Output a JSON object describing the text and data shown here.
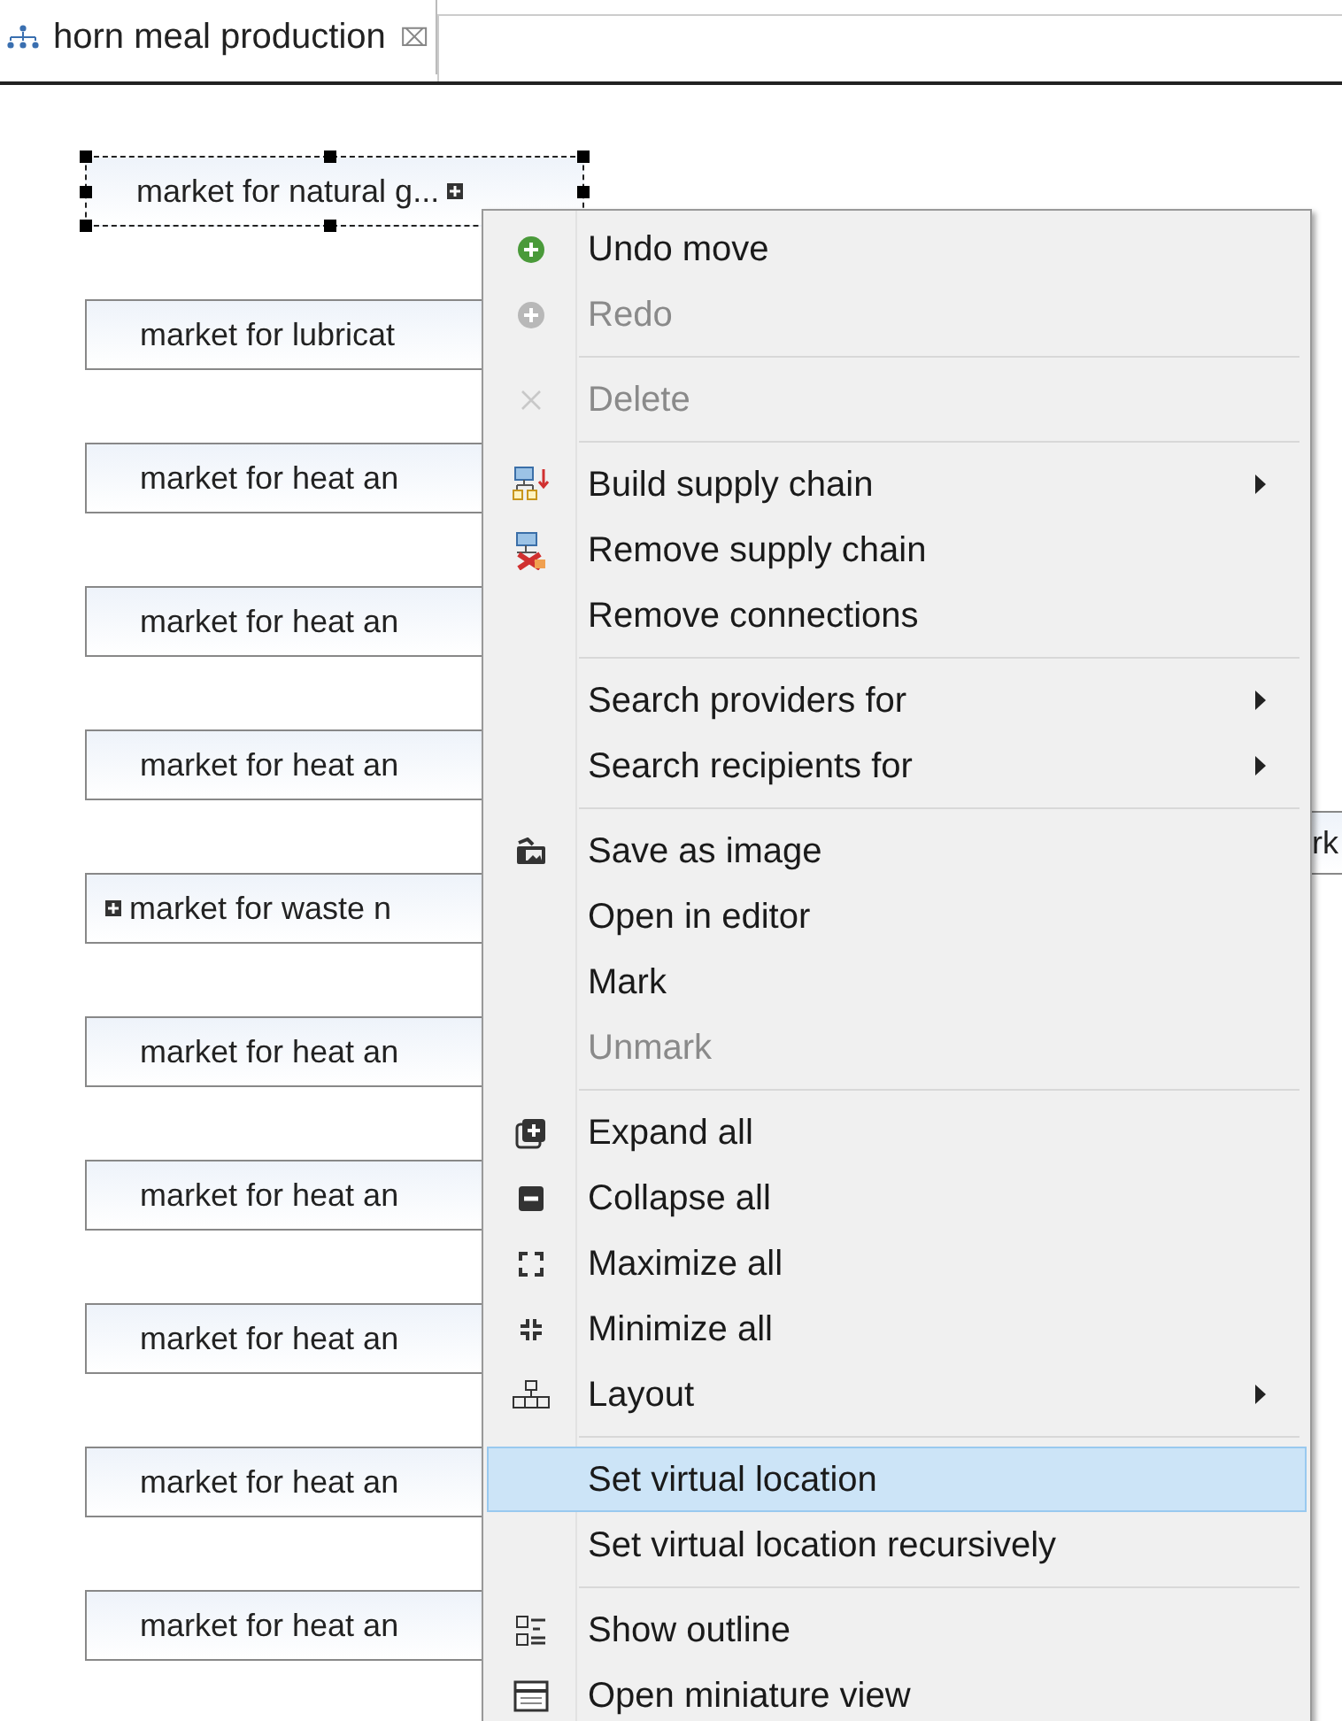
{
  "tab": {
    "title": "horn meal production",
    "close": "⌧"
  },
  "nodes": [
    {
      "label": "market for natural g...",
      "selected": true,
      "expander_left": false,
      "expander_right": true
    },
    {
      "label": "market for lubricat",
      "selected": false,
      "expander_left": false,
      "expander_right": false
    },
    {
      "label": "market for heat an",
      "selected": false,
      "expander_left": false,
      "expander_right": false
    },
    {
      "label": "market for heat an",
      "selected": false,
      "expander_left": false,
      "expander_right": false
    },
    {
      "label": "market for heat an",
      "selected": false,
      "expander_left": false,
      "expander_right": false
    },
    {
      "label": "market for waste n",
      "selected": false,
      "expander_left": true,
      "expander_right": false
    },
    {
      "label": "market for heat an",
      "selected": false,
      "expander_left": false,
      "expander_right": false
    },
    {
      "label": "market for heat an",
      "selected": false,
      "expander_left": false,
      "expander_right": false
    },
    {
      "label": "market for heat an",
      "selected": false,
      "expander_left": false,
      "expander_right": false
    },
    {
      "label": "market for heat an",
      "selected": false,
      "expander_left": false,
      "expander_right": false
    },
    {
      "label": "market for heat an",
      "selected": false,
      "expander_left": false,
      "expander_right": false
    }
  ],
  "side_node": {
    "label": "rk"
  },
  "context_menu": [
    {
      "kind": "item",
      "label": "Undo move",
      "disabled": false,
      "submenu": false,
      "selected": false
    },
    {
      "kind": "item",
      "label": "Redo",
      "disabled": true,
      "submenu": false,
      "selected": false
    },
    {
      "kind": "separator"
    },
    {
      "kind": "item",
      "label": "Delete",
      "disabled": true,
      "submenu": false,
      "selected": false
    },
    {
      "kind": "separator"
    },
    {
      "kind": "item",
      "label": "Build supply chain",
      "disabled": false,
      "submenu": true,
      "selected": false
    },
    {
      "kind": "item",
      "label": "Remove supply chain",
      "disabled": false,
      "submenu": false,
      "selected": false
    },
    {
      "kind": "item",
      "label": "Remove connections",
      "disabled": false,
      "submenu": false,
      "selected": false
    },
    {
      "kind": "separator"
    },
    {
      "kind": "item",
      "label": "Search providers for",
      "disabled": false,
      "submenu": true,
      "selected": false
    },
    {
      "kind": "item",
      "label": "Search recipients for",
      "disabled": false,
      "submenu": true,
      "selected": false
    },
    {
      "kind": "separator"
    },
    {
      "kind": "item",
      "label": "Save as image",
      "disabled": false,
      "submenu": false,
      "selected": false
    },
    {
      "kind": "item",
      "label": "Open in editor",
      "disabled": false,
      "submenu": false,
      "selected": false
    },
    {
      "kind": "item",
      "label": "Mark",
      "disabled": false,
      "submenu": false,
      "selected": false
    },
    {
      "kind": "item",
      "label": "Unmark",
      "disabled": true,
      "submenu": false,
      "selected": false
    },
    {
      "kind": "separator"
    },
    {
      "kind": "item",
      "label": "Expand all",
      "disabled": false,
      "submenu": false,
      "selected": false
    },
    {
      "kind": "item",
      "label": "Collapse all",
      "disabled": false,
      "submenu": false,
      "selected": false
    },
    {
      "kind": "item",
      "label": "Maximize all",
      "disabled": false,
      "submenu": false,
      "selected": false
    },
    {
      "kind": "item",
      "label": "Minimize all",
      "disabled": false,
      "submenu": false,
      "selected": false
    },
    {
      "kind": "item",
      "label": "Layout",
      "disabled": false,
      "submenu": true,
      "selected": false
    },
    {
      "kind": "separator"
    },
    {
      "kind": "item",
      "label": "Set virtual location",
      "disabled": false,
      "submenu": false,
      "selected": true
    },
    {
      "kind": "item",
      "label": "Set virtual location recursively",
      "disabled": false,
      "submenu": false,
      "selected": false
    },
    {
      "kind": "separator"
    },
    {
      "kind": "item",
      "label": "Show outline",
      "disabled": false,
      "submenu": false,
      "selected": false
    },
    {
      "kind": "item",
      "label": "Open miniature view",
      "disabled": false,
      "submenu": false,
      "selected": false
    }
  ]
}
